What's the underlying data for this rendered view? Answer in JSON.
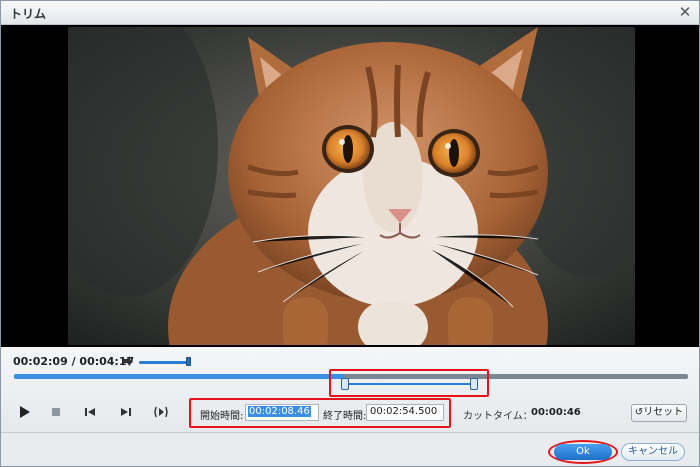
{
  "window": {
    "title": "トリム"
  },
  "video": {
    "subject": "cat"
  },
  "player": {
    "current_time": "00:02:09",
    "separator": " / ",
    "total_time": "00:04:17",
    "volume_level": 0.95,
    "progress": 0.49
  },
  "trim": {
    "start_fraction": 0.49,
    "end_fraction": 0.68
  },
  "time_fields": {
    "start_label": "開始時間:",
    "start_value": "00:02:08.46",
    "end_label": "終了時間:",
    "end_value": "00:02:54.500"
  },
  "cut": {
    "label": "カットタイム：",
    "value": "00:00:46"
  },
  "buttons": {
    "reset": "リセット",
    "ok": "Ok",
    "cancel": "キャンセル"
  },
  "colors": {
    "accent": "#2a7fd3",
    "highlight": "#e5141b"
  }
}
